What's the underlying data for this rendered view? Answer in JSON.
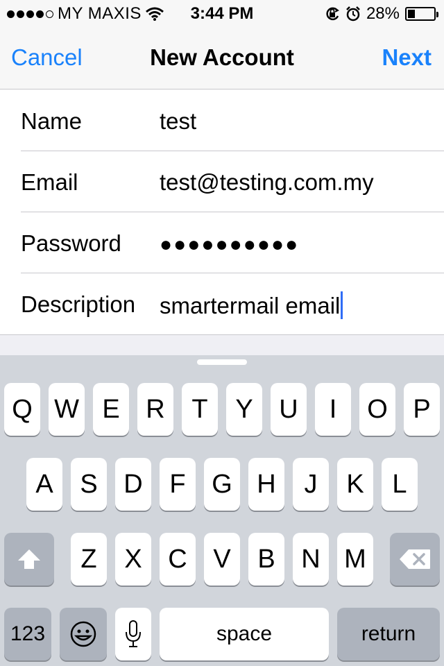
{
  "status_bar": {
    "carrier": "MY MAXIS",
    "time": "3:44 PM",
    "battery": "28%",
    "battery_level": 0.28,
    "signal_bars": 4,
    "signal_max": 5
  },
  "navbar": {
    "cancel_label": "Cancel",
    "title": "New Account",
    "next_label": "Next"
  },
  "form": {
    "fields": [
      {
        "label": "Name",
        "value": "test"
      },
      {
        "label": "Email",
        "value": "test@testing.com.my"
      },
      {
        "label": "Password",
        "value": "●●●●●●●●●●"
      },
      {
        "label": "Description",
        "value": "smartermail email"
      }
    ]
  },
  "keyboard": {
    "row1": [
      "Q",
      "W",
      "E",
      "R",
      "T",
      "Y",
      "U",
      "I",
      "O",
      "P"
    ],
    "row2": [
      "A",
      "S",
      "D",
      "F",
      "G",
      "H",
      "J",
      "K",
      "L"
    ],
    "row3": [
      "Z",
      "X",
      "C",
      "V",
      "B",
      "N",
      "M"
    ],
    "numbers_label": "123",
    "space_label": "space",
    "return_label": "return",
    "icons": {
      "shift": "shift-icon",
      "delete": "backspace-icon",
      "emoji": "emoji-icon",
      "mic": "microphone-icon"
    }
  },
  "colors": {
    "accent": "#1a82fb",
    "caret": "#2f6df6",
    "keyboard_bg": "#d1d5db",
    "key_dark": "#adb3bd"
  }
}
